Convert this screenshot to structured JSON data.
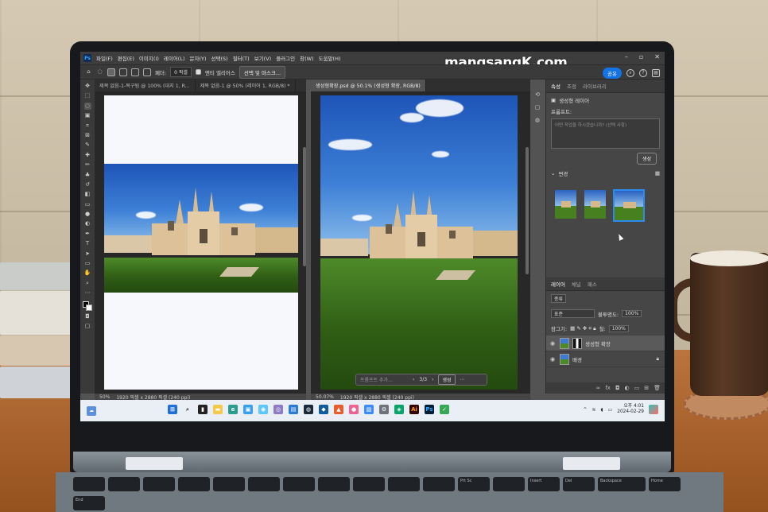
{
  "watermark": "mangsangK.com",
  "menu": [
    "파일(F)",
    "편집(E)",
    "이미지(I)",
    "레이어(L)",
    "문자(Y)",
    "선택(S)",
    "필터(T)",
    "보기(V)",
    "플러그인",
    "창(W)",
    "도움말(H)"
  ],
  "options": {
    "feather_label": "페더:",
    "feather_value": "0 픽셀",
    "antialias_label": "앤티 앨리어스",
    "select_mask_button": "선택 및 마스크...",
    "share_button": "공유"
  },
  "tabs": [
    {
      "label": "제목 없음-1-복구됨 @ 100% (대지 1, R...",
      "active": false
    },
    {
      "label": "제목 없음-1 @ 50% (레이어 1, RGB/8) *",
      "active": false
    },
    {
      "label": "생성형확장.psd @ 50.1% (생성형 확장, RGB/8)",
      "active": true
    }
  ],
  "status_left": {
    "zoom": "50%",
    "size": "1920 픽셀 x 2880 픽셀 (240 ppi)"
  },
  "status_right": {
    "zoom": "50.07%",
    "size": "1920 픽셀 x 2880 픽셀 (240 ppi)"
  },
  "context_bar": {
    "placeholder": "프롬프트 추가...",
    "page": "3/3",
    "generate": "생성"
  },
  "properties": {
    "tabs": [
      "속성",
      "조정",
      "라이브러리"
    ],
    "layer_type": "생성형 레이어",
    "prompt_label": "프롬프트:",
    "prompt_placeholder": "어떤 작업을 하시겠습니까? (선택 사항)",
    "generate_button": "생성",
    "variations_label": "변경"
  },
  "layers_panel": {
    "tabs": [
      "레이어",
      "채널",
      "패스"
    ],
    "filter_label": "종류",
    "blend_mode": "표준",
    "opacity_label": "불투명도:",
    "opacity_value": "100%",
    "lock_label": "잠그기:",
    "fill_label": "칠:",
    "fill_value": "100%",
    "layers": [
      {
        "name": "생성형 확장",
        "selected": true
      },
      {
        "name": "배경",
        "selected": false
      }
    ]
  },
  "taskbar": {
    "time": "오후 4:01",
    "date": "2024-02-29"
  },
  "keyboard_labels": [
    "Prt Sc",
    "Insert",
    "Del",
    "Backspace",
    "Home",
    "End"
  ]
}
